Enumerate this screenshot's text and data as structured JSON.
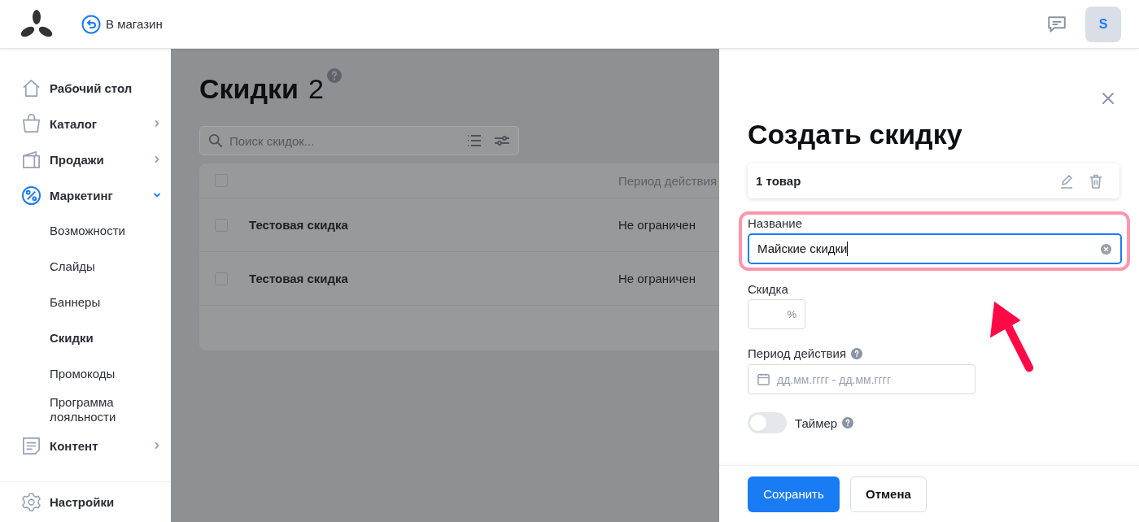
{
  "header": {
    "back_link": "В магазин",
    "avatar": "S"
  },
  "sidebar": {
    "items": [
      {
        "label": "Рабочий стол",
        "kind": "home",
        "selected": false
      },
      {
        "label": "Каталог",
        "kind": "bag",
        "selected": false,
        "expanded": false
      },
      {
        "label": "Продажи",
        "kind": "wallet",
        "selected": false,
        "expanded": false
      },
      {
        "label": "Маркетинг",
        "kind": "percent",
        "selected": true,
        "expanded": true,
        "children": [
          {
            "label": "Возможности",
            "selected": false
          },
          {
            "label": "Слайды",
            "selected": false
          },
          {
            "label": "Баннеры",
            "selected": false
          },
          {
            "label": "Скидки",
            "selected": true
          },
          {
            "label": "Промокоды",
            "selected": false
          },
          {
            "label": "Программа лояльности",
            "selected": false
          }
        ]
      },
      {
        "label": "Контент",
        "kind": "document",
        "selected": false,
        "expanded": false
      }
    ],
    "footer": {
      "label": "Настройки",
      "kind": "gear"
    }
  },
  "page": {
    "title": "Скидки",
    "count": "2",
    "search": {
      "placeholder": "Поиск скидок..."
    },
    "table": {
      "columns": [
        {
          "label": "Период действия"
        }
      ],
      "header_checked": false,
      "rows": [
        {
          "name": "Тестовая скидка",
          "period": "Не ограничен",
          "checked": false
        },
        {
          "name": "Тестовая скидка",
          "period": "Не ограничен",
          "checked": false
        }
      ]
    }
  },
  "drawer": {
    "title": "Создать скидку",
    "product_card": "1 товар",
    "name_field": {
      "label": "Название",
      "value": "Майские скидки"
    },
    "discount_field": {
      "label": "Скидка",
      "suffix": "%"
    },
    "period_field": {
      "label": "Период действия",
      "placeholder": "дд.мм.гггг - дд.мм.гггг"
    },
    "timer": {
      "label": "Таймер",
      "on": false
    },
    "buttons": [
      {
        "label": "Сохранить",
        "kind": "primary"
      },
      {
        "label": "Отмена",
        "kind": "secondary"
      }
    ]
  }
}
